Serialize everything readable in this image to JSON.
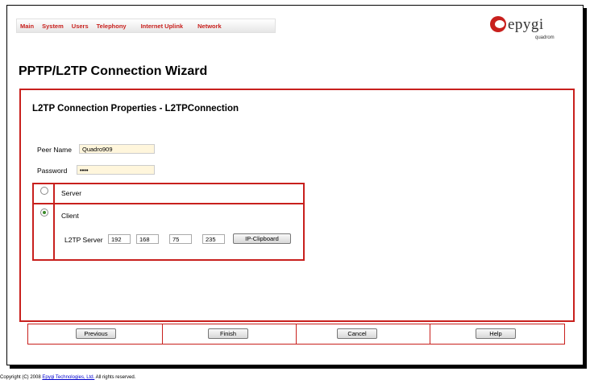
{
  "nav": {
    "items": [
      {
        "label": "Main"
      },
      {
        "label": "System"
      },
      {
        "label": "Users"
      },
      {
        "label": "Telephony"
      },
      {
        "label": "Internet Uplink"
      },
      {
        "label": "Network"
      }
    ]
  },
  "logo": {
    "name": "epygi",
    "sub": "quadrom"
  },
  "page": {
    "title": "PPTP/L2TP Connection Wizard"
  },
  "section": {
    "title": "L2TP Connection Properties - L2TPConnection"
  },
  "form": {
    "peer_name_label": "Peer Name",
    "peer_name_value": "Quadro909",
    "password_label": "Password",
    "password_value": "••••"
  },
  "options": {
    "server_label": "Server",
    "client_label": "Client",
    "selected": "Client",
    "l2tp_server_label": "L2TP Server",
    "ip": [
      "192",
      "168",
      "75",
      "235"
    ],
    "ip_clipboard_label": "IP-Clipboard"
  },
  "buttons": {
    "previous": "Previous",
    "finish": "Finish",
    "cancel": "Cancel",
    "help": "Help"
  },
  "footer": {
    "prefix": "Copyright (C) 2008 ",
    "link": "Epygi Technologies, Ltd.",
    "suffix": " All rights reserved."
  },
  "colors": {
    "accent": "#c8201d",
    "input_bg": "#fff6dc"
  }
}
